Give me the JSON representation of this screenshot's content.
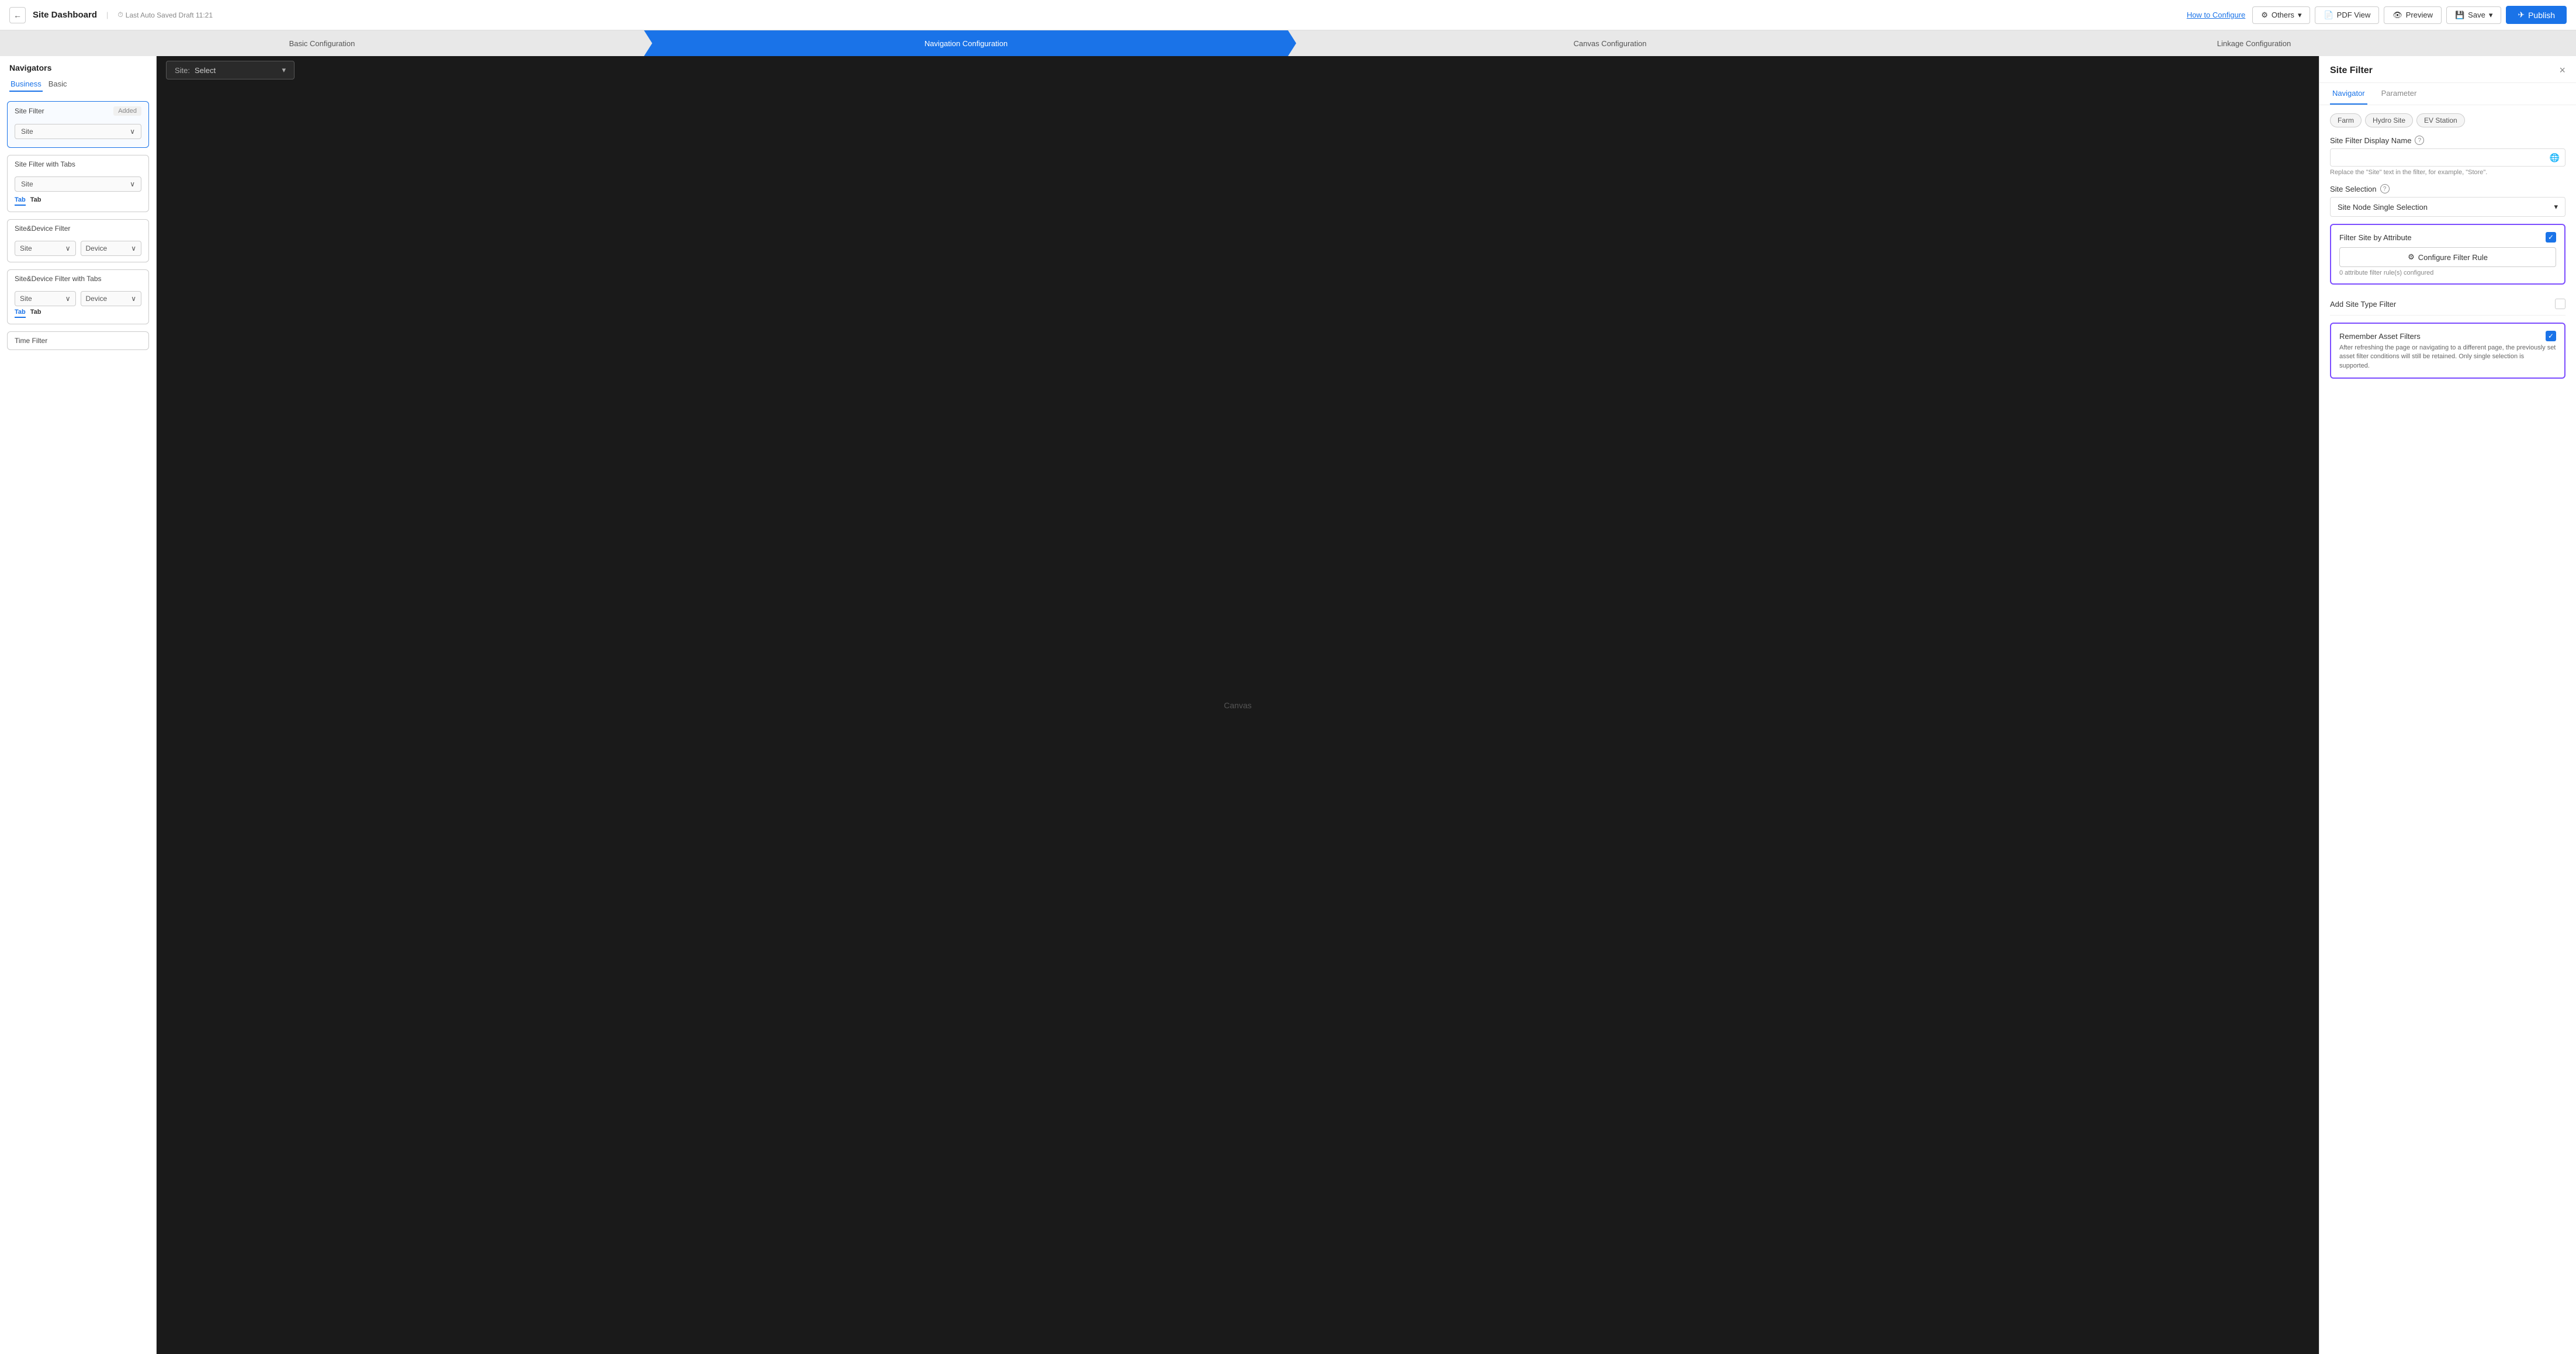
{
  "header": {
    "back_icon": "←",
    "title": "Site Dashboard",
    "divider": "|",
    "draft_icon": "⏱",
    "draft_text": "Last Auto Saved Draft 11:21",
    "how_to_configure": "How to Configure",
    "others_label": "Others",
    "others_icon": "⚙",
    "pdf_view_label": "PDF View",
    "pdf_icon": "📄",
    "preview_label": "Preview",
    "preview_icon": "👁",
    "save_label": "Save",
    "save_icon": "💾",
    "publish_label": "Publish",
    "publish_icon": "✈"
  },
  "steps": [
    {
      "label": "Basic Configuration",
      "active": false
    },
    {
      "label": "Navigation Configuration",
      "active": true
    },
    {
      "label": "Canvas Configuration",
      "active": false
    },
    {
      "label": "Linkage Configuration",
      "active": false
    }
  ],
  "left_panel": {
    "title": "Navigators",
    "tabs": [
      {
        "label": "Business",
        "active": true
      },
      {
        "label": "Basic",
        "active": false
      }
    ],
    "cards": [
      {
        "title": "Site Filter",
        "badge": "Added",
        "selected": true,
        "body_type": "single_select",
        "select_label": "Site"
      },
      {
        "title": "Site Filter with Tabs",
        "badge": "",
        "selected": false,
        "body_type": "tabs_select",
        "select_label": "Site",
        "tab1": "Tab",
        "tab2": "Tab"
      },
      {
        "title": "Site&Device Filter",
        "badge": "",
        "selected": false,
        "body_type": "device_select",
        "select1": "Site",
        "select2": "Device"
      },
      {
        "title": "Site&Device Filter with Tabs",
        "badge": "",
        "selected": false,
        "body_type": "device_tabs",
        "select1": "Site",
        "select2": "Device",
        "tab1": "Tab",
        "tab2": "Tab"
      },
      {
        "title": "Time Filter",
        "badge": "",
        "selected": false,
        "body_type": "simple"
      }
    ]
  },
  "canvas": {
    "site_label": "Site:",
    "site_placeholder": "Select",
    "canvas_text": "Canvas"
  },
  "right_panel": {
    "title": "Site Filter",
    "close_icon": "×",
    "tabs": [
      {
        "label": "Navigator",
        "active": true
      },
      {
        "label": "Parameter",
        "active": false
      }
    ],
    "filter_chips": [
      "Farm",
      "Hydro Site",
      "EV Station"
    ],
    "display_name_label": "Site Filter Display Name",
    "display_name_placeholder": "",
    "globe_icon": "🌐",
    "display_name_hint": "Replace the \"Site\" text in the filter, for example, \"Store\".",
    "site_selection_label": "Site Selection",
    "site_selection_value": "Site Node Single Selection",
    "filter_by_attr_label": "Filter Site by Attribute",
    "filter_checked": true,
    "configure_btn_label": "Configure Filter Rule",
    "configure_icon": "⚙",
    "attr_count": "0 attribute filter rule(s) configured",
    "add_site_type_label": "Add Site Type Filter",
    "add_site_type_checked": false,
    "remember_label": "Remember Asset Filters",
    "remember_checked": true,
    "remember_desc": "After refreshing the page or navigating to a different page, the previously set asset filter conditions will still be retained. Only single selection is supported."
  }
}
